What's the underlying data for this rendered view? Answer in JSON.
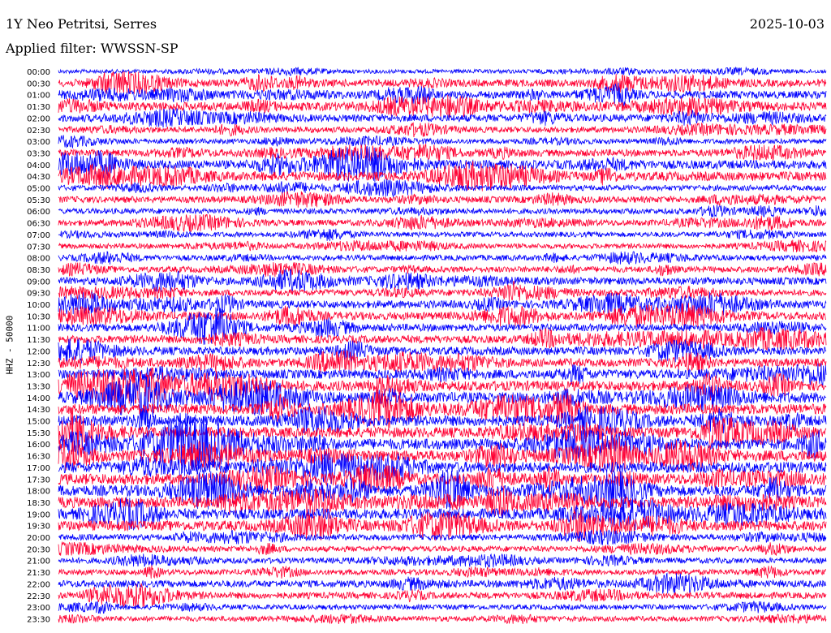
{
  "header": {
    "station": "1Y Neo Petritsi, Serres",
    "date": "2025-10-03",
    "filter": "Applied filter: WWSSN-SP"
  },
  "chart_data": {
    "type": "line",
    "title": "1Y Neo Petritsi, Serres",
    "ylabel": "HHZ - 50000",
    "row_labels": [
      "00:00",
      "00:30",
      "01:00",
      "01:30",
      "02:00",
      "02:30",
      "03:00",
      "03:30",
      "04:00",
      "04:30",
      "05:00",
      "05:30",
      "06:00",
      "06:30",
      "07:00",
      "07:30",
      "08:00",
      "08:30",
      "09:00",
      "09:30",
      "10:00",
      "10:30",
      "11:00",
      "11:30",
      "12:00",
      "12:30",
      "13:00",
      "13:30",
      "14:00",
      "14:30",
      "15:00",
      "15:30",
      "16:00",
      "16:30",
      "17:00",
      "17:30",
      "18:00",
      "18:30",
      "19:00",
      "19:30",
      "20:00",
      "20:30",
      "21:00",
      "21:30",
      "22:00",
      "22:30",
      "23:00",
      "23:30"
    ],
    "row_colors": [
      "#0000ff",
      "#ff0033"
    ],
    "activity_level": [
      0.18,
      0.55,
      0.6,
      0.7,
      0.55,
      0.4,
      0.3,
      0.5,
      0.7,
      0.75,
      0.35,
      0.45,
      0.35,
      0.4,
      0.3,
      0.3,
      0.35,
      0.4,
      0.55,
      0.45,
      0.6,
      0.6,
      0.55,
      0.6,
      0.65,
      0.65,
      0.75,
      0.85,
      0.9,
      0.9,
      0.9,
      0.9,
      0.95,
      0.95,
      0.95,
      0.95,
      0.95,
      0.95,
      0.9,
      0.85,
      0.4,
      0.35,
      0.35,
      0.35,
      0.5,
      0.45,
      0.3,
      0.3
    ]
  }
}
